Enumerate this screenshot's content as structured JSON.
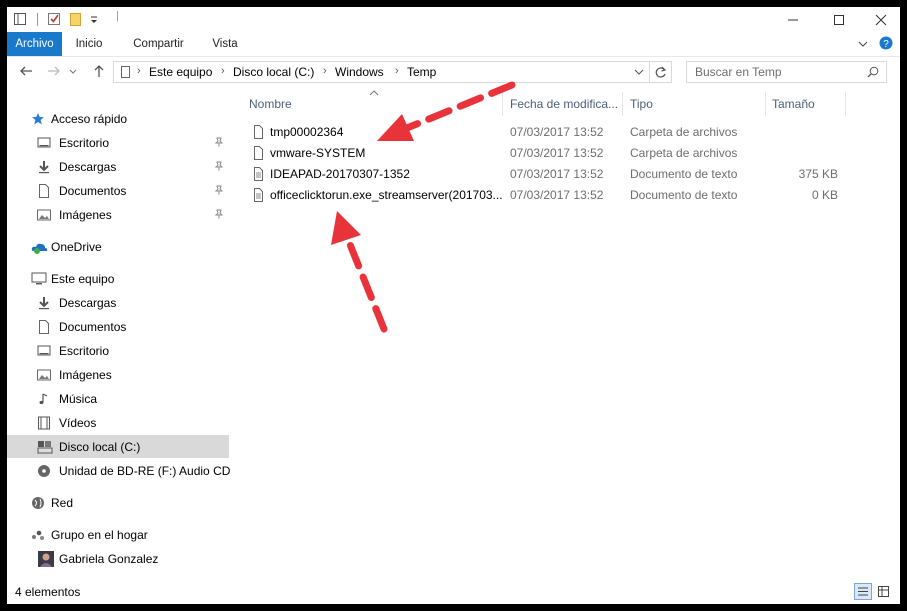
{
  "ribbon": {
    "tabs": [
      {
        "label": "Archivo",
        "active": true
      },
      {
        "label": "Inicio"
      },
      {
        "label": "Compartir"
      },
      {
        "label": "Vista"
      }
    ]
  },
  "address": {
    "breadcrumbs": [
      "Este equipo",
      "Disco local (C:)",
      "Windows",
      "Temp"
    ]
  },
  "search": {
    "placeholder": "Buscar en Temp"
  },
  "nav": {
    "quick_access": "Acceso rápido",
    "quick_items": [
      {
        "label": "Escritorio",
        "icon": "desktop-icon",
        "pinned": true
      },
      {
        "label": "Descargas",
        "icon": "download-icon",
        "pinned": true
      },
      {
        "label": "Documentos",
        "icon": "document-icon",
        "pinned": true
      },
      {
        "label": "Imágenes",
        "icon": "pictures-icon",
        "pinned": true
      }
    ],
    "onedrive": "OneDrive",
    "this_pc": "Este equipo",
    "pc_items": [
      {
        "label": "Descargas",
        "icon": "download-icon"
      },
      {
        "label": "Documentos",
        "icon": "document-icon"
      },
      {
        "label": "Escritorio",
        "icon": "desktop-icon"
      },
      {
        "label": "Imágenes",
        "icon": "pictures-icon"
      },
      {
        "label": "Música",
        "icon": "music-icon"
      },
      {
        "label": "Vídeos",
        "icon": "video-icon"
      },
      {
        "label": "Disco local (C:)",
        "icon": "drive-icon",
        "selected": true
      },
      {
        "label": "Unidad de BD-RE (F:) Audio CD",
        "icon": "disc-icon"
      }
    ],
    "network": "Red",
    "homegroup": "Grupo en el hogar",
    "user": "Gabriela Gonzalez"
  },
  "columns": {
    "name": "Nombre",
    "date": "Fecha de modifica...",
    "type": "Tipo",
    "size": "Tamaño"
  },
  "files": [
    {
      "name": "tmp00002364",
      "date": "07/03/2017 13:52",
      "type": "Carpeta de archivos",
      "size": "",
      "icon": "folder-icon"
    },
    {
      "name": "vmware-SYSTEM",
      "date": "07/03/2017 13:52",
      "type": "Carpeta de archivos",
      "size": "",
      "icon": "folder-icon"
    },
    {
      "name": "IDEAPAD-20170307-1352",
      "date": "07/03/2017 13:52",
      "type": "Documento de texto",
      "size": "375 KB",
      "icon": "text-file-icon"
    },
    {
      "name": "officeclicktorun.exe_streamserver(201703...",
      "date": "07/03/2017 13:52",
      "type": "Documento de texto",
      "size": "0 KB",
      "icon": "text-file-icon"
    }
  ],
  "status": {
    "count": "4 elementos"
  },
  "colors": {
    "accent": "#1979ca",
    "annotation_arrow": "#e8333b",
    "selected_nav": "#d9d9d9"
  }
}
